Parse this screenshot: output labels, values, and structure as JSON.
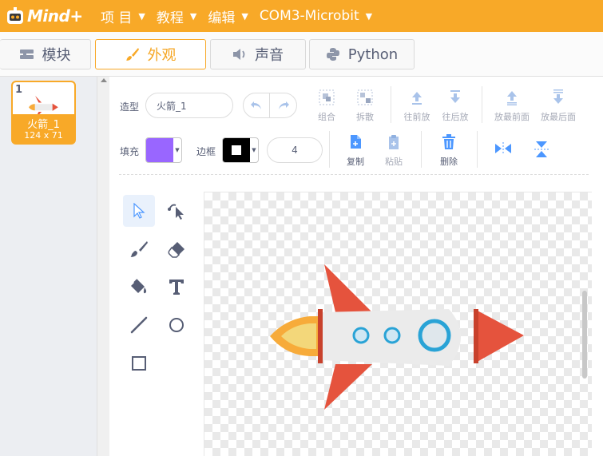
{
  "app": {
    "logo_text": "Mind+",
    "brand_color": "#f8a928"
  },
  "menu": {
    "items": [
      {
        "label": "项 目",
        "icon": "chevron-down-icon"
      },
      {
        "label": "教程",
        "icon": "chevron-down-icon"
      },
      {
        "label": "编辑",
        "icon": "chevron-down-icon"
      },
      {
        "label": "COM3-Microbit",
        "icon": "chevron-down-icon"
      }
    ]
  },
  "tabs": [
    {
      "label": "模块",
      "icon": "blocks-icon",
      "active": false
    },
    {
      "label": "外观",
      "icon": "paintbrush-icon",
      "active": true
    },
    {
      "label": "声音",
      "icon": "speaker-icon",
      "active": false
    },
    {
      "label": "Python",
      "icon": "python-icon",
      "active": false
    }
  ],
  "costume_list": {
    "items": [
      {
        "number": "1",
        "name": "火箭_1",
        "size": "124 x 71",
        "selected": true
      }
    ]
  },
  "editor": {
    "costume_label": "造型",
    "costume_name": "火箭_1",
    "fill_label": "填充",
    "fill_color": "#9966ff",
    "outline_label": "边框",
    "outline_color": "#000000",
    "stroke_width": "4",
    "toolbar": {
      "group": "组合",
      "ungroup": "拆散",
      "forward": "往前放",
      "backward": "往后放",
      "front": "放最前面",
      "back": "放最后面",
      "copy": "复制",
      "paste": "粘贴",
      "delete": "删除"
    },
    "tools": [
      {
        "name": "select",
        "icon": "select-arrow-icon",
        "active": true
      },
      {
        "name": "reshape",
        "icon": "reshape-icon",
        "active": false
      },
      {
        "name": "brush",
        "icon": "brush-icon",
        "active": false
      },
      {
        "name": "eraser",
        "icon": "eraser-icon",
        "active": false
      },
      {
        "name": "fill",
        "icon": "fill-bucket-icon",
        "active": false
      },
      {
        "name": "text",
        "icon": "text-icon",
        "active": false
      },
      {
        "name": "line",
        "icon": "line-icon",
        "active": false
      },
      {
        "name": "circle",
        "icon": "circle-icon",
        "active": false
      },
      {
        "name": "rectangle",
        "icon": "rectangle-icon",
        "active": false
      }
    ]
  }
}
